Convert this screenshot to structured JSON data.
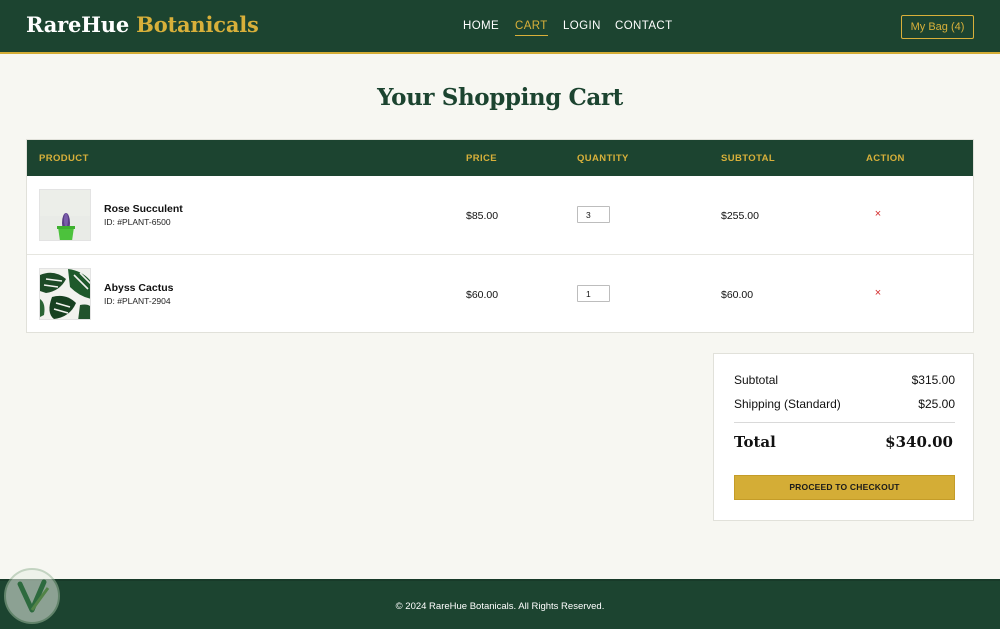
{
  "header": {
    "logo_main": "RareHue",
    "logo_accent": "Botanicals",
    "nav": [
      {
        "label": "HOME",
        "active": false
      },
      {
        "label": "CART",
        "active": true
      },
      {
        "label": "LOGIN",
        "active": false
      },
      {
        "label": "CONTACT",
        "active": false
      }
    ],
    "bag_label": "My Bag (4)"
  },
  "page_title": "Your Shopping Cart",
  "table": {
    "columns": [
      "PRODUCT",
      "PRICE",
      "QUANTITY",
      "SUBTOTAL",
      "ACTION"
    ],
    "rows": [
      {
        "thumb": "succulent-photo",
        "name": "Rose Succulent",
        "id": "ID: #PLANT-6500",
        "price": "$85.00",
        "quantity": "3",
        "subtotal": "$255.00",
        "remove_icon": "×"
      },
      {
        "thumb": "monstera-leaf-photo",
        "name": "Abyss Cactus",
        "id": "ID: #PLANT-2904",
        "price": "$60.00",
        "quantity": "1",
        "subtotal": "$60.00",
        "remove_icon": "×"
      }
    ]
  },
  "summary": {
    "subtotal_label": "Subtotal",
    "subtotal_value": "$315.00",
    "shipping_label": "Shipping (Standard)",
    "shipping_value": "$25.00",
    "total_label": "Total",
    "total_value": "$340.00",
    "checkout_label": "PROCEED TO CHECKOUT"
  },
  "footer": {
    "copyright": "© 2024 RareHue Botanicals. All Rights Reserved."
  },
  "colors": {
    "primary_green": "#1c4430",
    "accent_gold": "#d8b03a",
    "remove_red": "#d42a2a",
    "background": "#f7f7f2"
  }
}
